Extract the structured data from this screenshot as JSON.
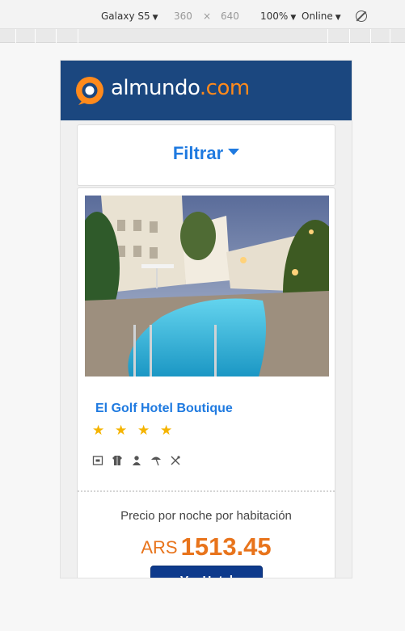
{
  "devtools": {
    "device": "Galaxy S5",
    "width": "360",
    "times": "×",
    "height": "640",
    "zoom": "100%",
    "network": "Online",
    "rotate_icon": "rotate-icon"
  },
  "site": {
    "logo_main": "almundo",
    "logo_tld": ".com",
    "colors": {
      "header": "#1b477f",
      "brand_orange": "#ff8a1c",
      "link_blue": "#1f7ae0",
      "price_orange": "#e8741c",
      "button": "#0e3a8c"
    }
  },
  "filter": {
    "label": "Filtrar"
  },
  "hotel": {
    "name": "El Golf Hotel Boutique",
    "stars": 4,
    "star_glyph": "★",
    "amenities": [
      "safe-icon",
      "bathrobe-icon",
      "person-icon",
      "beach-umbrella-icon",
      "restaurant-icon"
    ],
    "price_caption": "Precio por noche por habitación",
    "currency": "ARS",
    "price": "1513.45",
    "button_label": "Ver Hotel"
  }
}
